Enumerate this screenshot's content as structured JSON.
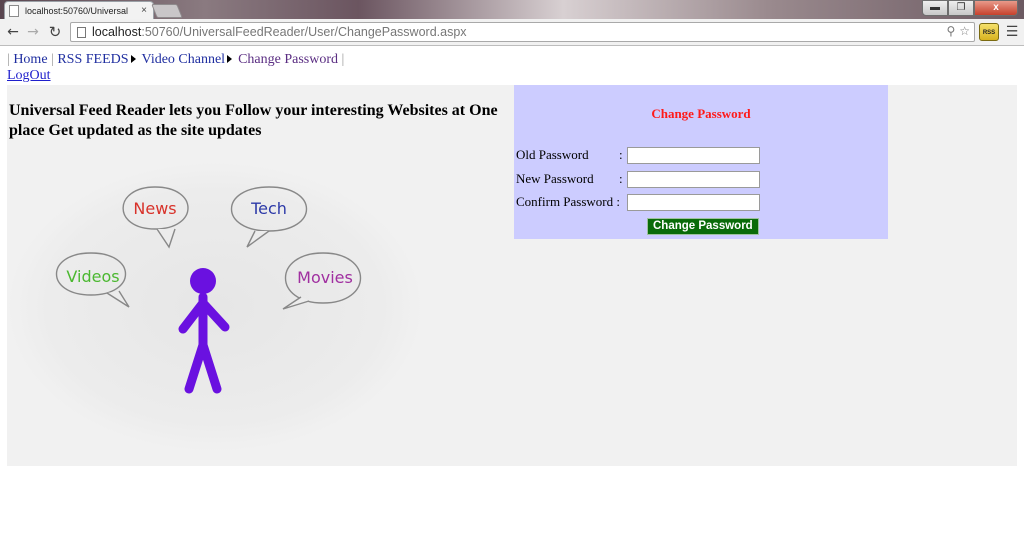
{
  "browser": {
    "tab_title": "localhost:50760/Universal",
    "tab_close": "×",
    "url_host": "localhost",
    "url_path": ":50760/UniversalFeedReader/User/ChangePassword.aspx",
    "window_buttons": {
      "minimize": "▬",
      "maximize": "❐",
      "close": "x"
    },
    "ext_label": "RSS"
  },
  "nav": {
    "separator": "|",
    "home": "Home",
    "rss_feeds": "RSS FEEDS",
    "video_channel": "Video Channel",
    "change_password": "Change Password",
    "logout": "LogOut"
  },
  "intro_text": "Universal Feed Reader lets you Follow your interesting Websites at One place Get updated as the site updates",
  "illustration": {
    "bubbles": [
      "News",
      "Tech",
      "Videos",
      "Movies"
    ],
    "colors": {
      "news": "#d8322a",
      "tech": "#2d3aa8",
      "videos": "#4bb830",
      "movies": "#a02fa0",
      "figure": "#6a11e0"
    }
  },
  "change_password_form": {
    "title": "Change Password",
    "old_label": "Old Password",
    "new_label": "New Password",
    "confirm_label": "Confirm Password :",
    "colon": ":",
    "old_value": "",
    "new_value": "",
    "confirm_value": "",
    "submit_label": "Change Password",
    "title_color": "#ff1a1a",
    "panel_color": "#ccccff",
    "button_color": "#0a6b0a"
  }
}
